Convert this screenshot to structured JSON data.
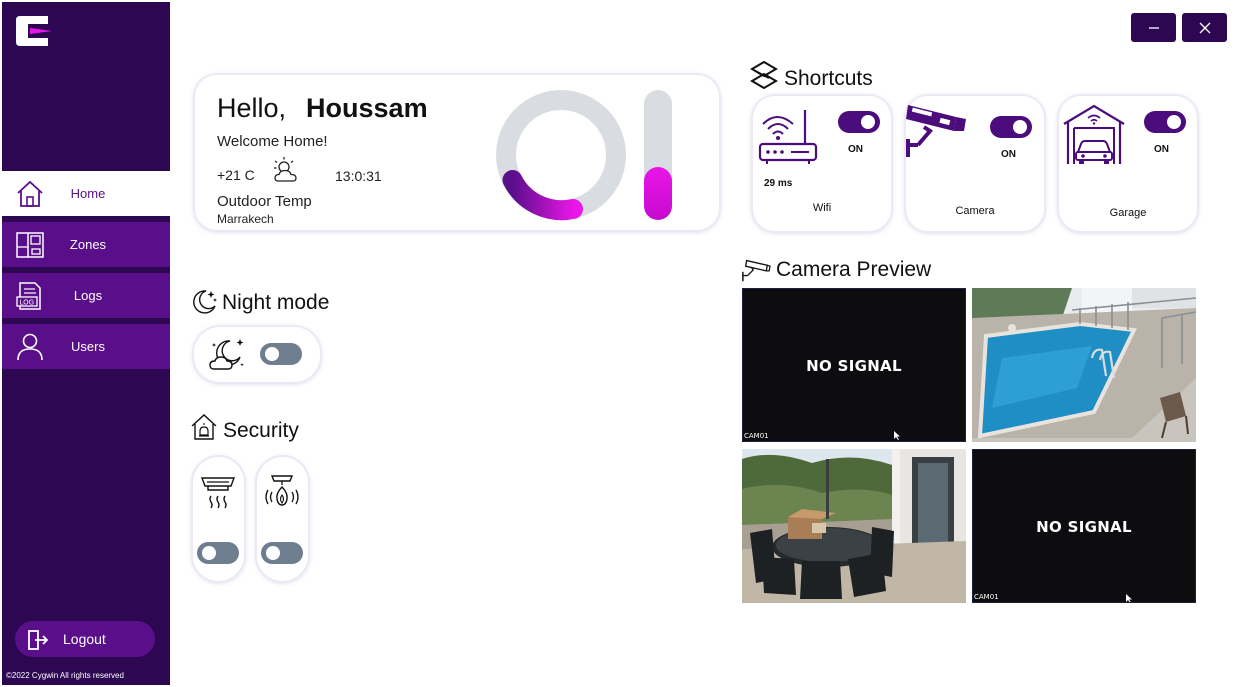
{
  "window": {
    "minimize_icon": "minimize-icon",
    "close_icon": "close-icon",
    "accent": "#2d0752"
  },
  "sidebar": {
    "logo_icon": "app-logo-icon",
    "items": [
      {
        "label": "Home",
        "icon": "home-icon",
        "active": true
      },
      {
        "label": "Zones",
        "icon": "zones-icon",
        "active": false
      },
      {
        "label": "Logs",
        "icon": "logs-icon",
        "active": false
      },
      {
        "label": "Users",
        "icon": "user-icon",
        "active": false
      }
    ],
    "logout_label": "Logout",
    "copyright": "©2022 Cygwin All rights reserved",
    "colors": {
      "background": "#2d0752",
      "item": "#5a0f8a",
      "active_item": "#ffffff"
    }
  },
  "greeting": {
    "hello": "Hello,",
    "name": "Houssam",
    "welcome": "Welcome Home!",
    "temperature": "+21 C",
    "weather_icon": "partly-cloudy-icon",
    "time": "13:0:31",
    "outdoor_label": "Outdoor Temp",
    "city": "Marrakech",
    "ring_colors": {
      "track": "#d9dde2",
      "fill_start": "#5a0f8a",
      "fill_end": "#e816e8"
    }
  },
  "night_mode": {
    "title": "Night mode",
    "title_icon": "moon-stars-icon",
    "card_icon": "moon-clouds-icon",
    "enabled": false
  },
  "security": {
    "title": "Security",
    "title_icon": "home-alarm-icon",
    "sensors": [
      {
        "icon": "smoke-detector-icon",
        "enabled": false
      },
      {
        "icon": "fire-detector-icon",
        "enabled": false
      }
    ]
  },
  "shortcuts": {
    "title": "Shortcuts",
    "title_icon": "shortcuts-logo-icon",
    "items": [
      {
        "label": "Wifi",
        "icon": "router-icon",
        "state": "ON",
        "enabled": true,
        "latency": "29 ms"
      },
      {
        "label": "Camera",
        "icon": "security-camera-icon",
        "state": "ON",
        "enabled": true
      },
      {
        "label": "Garage",
        "icon": "garage-icon",
        "state": "ON",
        "enabled": true
      }
    ]
  },
  "camera_preview": {
    "title": "Camera Preview",
    "title_icon": "cctv-icon",
    "feeds": [
      {
        "status": "NO SIGNAL",
        "tag": "CAM01"
      },
      {
        "status": "",
        "scene": "pool"
      },
      {
        "status": "",
        "scene": "patio"
      },
      {
        "status": "NO SIGNAL",
        "tag": "CAM01"
      }
    ]
  }
}
